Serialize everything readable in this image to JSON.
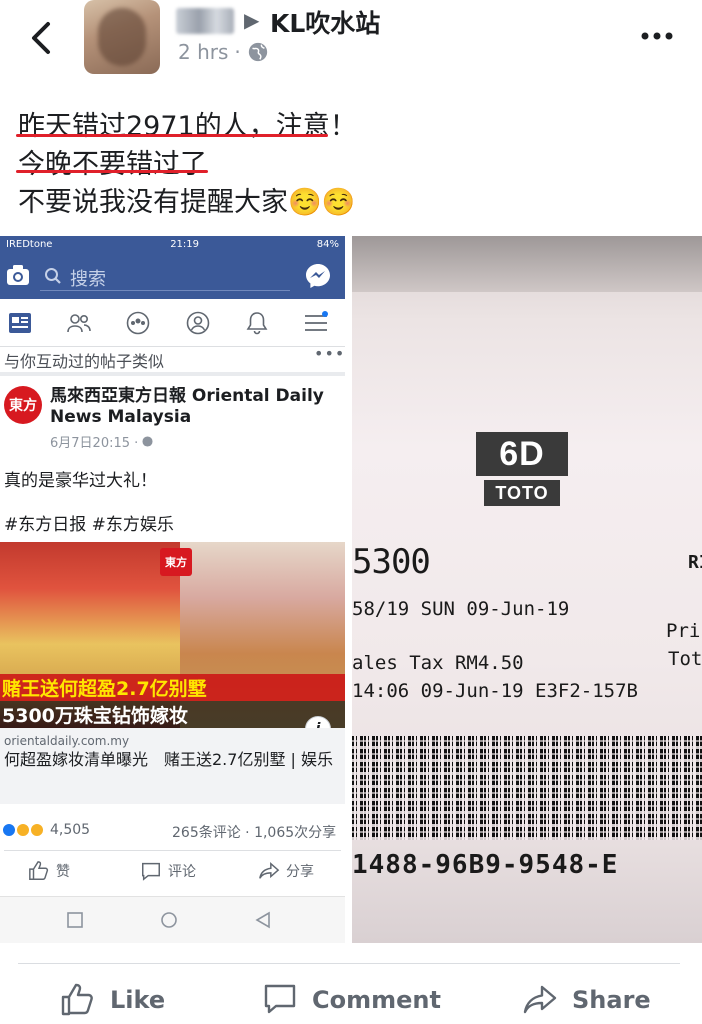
{
  "header": {
    "page_name": "KL吹水站",
    "time": "2 hrs"
  },
  "caption": {
    "line1": "昨天错过2971的人，注意！",
    "line2": "今晚不要错过了",
    "line3": "不要说我没有提醒大家☺️☺️"
  },
  "screenshot": {
    "status": {
      "carrier": "IREDtone",
      "time": "21:19",
      "battery": "84%"
    },
    "search_placeholder": "搜索",
    "section_header": "与你互动过的帖子类似",
    "section_more": "•••",
    "page": {
      "logo_text": "東方",
      "name": "馬來西亞東方日報 Oriental Daily News Malaysia",
      "date": "6月7日20:15 ·"
    },
    "post_line1": "真的是豪华过大礼！",
    "post_line2": "#东方日报 #东方娱乐",
    "photo": {
      "logo_text": "東方",
      "overlay1": "赌王送何超盈2.7亿别墅",
      "overlay2": "5300万珠宝钻饰嫁妆"
    },
    "link": {
      "domain": "orientaldaily.com.my",
      "title": "何超盈嫁妆清单曝光　赌王送2.7亿别墅 | 娱乐"
    },
    "reactions_count": "4,505",
    "stats": "265条评论 · 1,065次分享",
    "actions": {
      "like": "赞",
      "comment": "评论",
      "share": "分享"
    }
  },
  "ticket": {
    "brand_top": "6D",
    "brand_bottom": "TOTO",
    "number": "5300",
    "corner_rm": "RI",
    "draw_line": "58/19  SUN 09-Jun-19",
    "price_label": "Pric",
    "total_label": "Tot",
    "tax_line": "ales Tax RM4.50",
    "time_line": "14:06 09-Jun-19 E3F2-157B",
    "serial": "1488-96B9-9548-E"
  },
  "footer": {
    "like": "Like",
    "comment": "Comment",
    "share": "Share"
  },
  "colors": {
    "fb_blue": "#3b5998",
    "underline_red": "#e0202a",
    "meta_gray": "#8d949e"
  }
}
